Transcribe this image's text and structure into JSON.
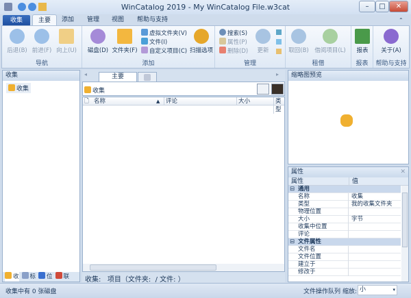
{
  "window": {
    "title": "WinCatalog 2019 - My WinCatalog File.w3cat",
    "minimize": "–",
    "maximize": "□",
    "close": "✕"
  },
  "file_tab": "收集",
  "tabs": [
    "主要",
    "添加",
    "管理",
    "视图",
    "帮助与支持"
  ],
  "groups": {
    "nav": {
      "label": "导航",
      "back": "后退(B)",
      "forward": "前进(F)",
      "up": "向上(U)"
    },
    "add": {
      "label": "添加",
      "disk": "磁盘(D)",
      "folder": "文件夹(F)",
      "virtual_folder": "虚拟文件夹(V)",
      "file": "文件(I)",
      "custom_item": "自定义项目(C)",
      "scan_options": "扫描选项"
    },
    "manage": {
      "label": "管理",
      "search": "搜索(S)",
      "properties": "属性(P)",
      "delete": "删除(D)",
      "update": "更新"
    },
    "lending": {
      "label": "租借",
      "return": "取回(B)",
      "lend": "借阅项目(L)"
    },
    "reports": {
      "label": "报表",
      "report": "报表"
    },
    "help": {
      "label": "帮助与支持",
      "about": "关于(A)"
    }
  },
  "left_pane": {
    "title": "收集",
    "tree_item": "收集",
    "bottom_tabs": [
      "收",
      "标",
      "位",
      "联"
    ]
  },
  "center": {
    "tabs": [
      "主要",
      ""
    ],
    "path": "收集",
    "columns": [
      "名称",
      "评论",
      "大小",
      "类型"
    ],
    "status": "收集:   项目（文件夹:  / 文件: ）"
  },
  "thumbnail": {
    "title": "缩略图预览"
  },
  "properties": {
    "title": "属性",
    "col_name": "属性",
    "col_value": "值",
    "rows": [
      {
        "cat": true,
        "k": "通用",
        "v": ""
      },
      {
        "k": "名称",
        "v": "收集"
      },
      {
        "k": "类型",
        "v": "我的收集文件夹"
      },
      {
        "k": "物理位置",
        "v": ""
      },
      {
        "k": "大小",
        "v": " 字节"
      },
      {
        "k": "收集中位置",
        "v": ""
      },
      {
        "k": "评论",
        "v": ""
      },
      {
        "cat": true,
        "k": "文件属性",
        "v": ""
      },
      {
        "k": "文件名",
        "v": ""
      },
      {
        "k": "文件位置",
        "v": ""
      },
      {
        "k": "建立于",
        "v": ""
      },
      {
        "k": "修改于",
        "v": ""
      }
    ]
  },
  "statusbar": {
    "left": "收集中有 0 张磁盘",
    "queue": "文件操作队列",
    "zoom_label": "缩放:",
    "zoom_value": "小"
  }
}
